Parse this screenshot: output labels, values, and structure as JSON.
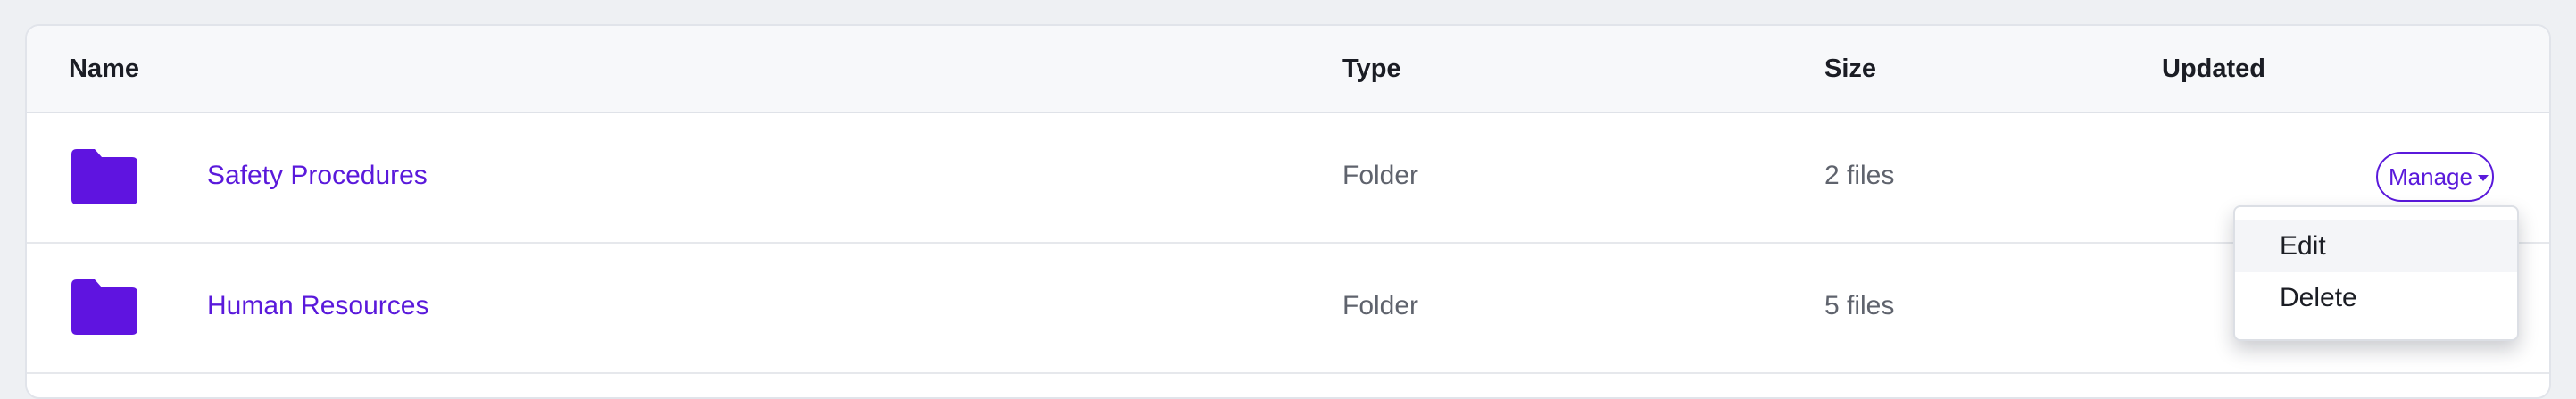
{
  "table": {
    "columns": {
      "name": "Name",
      "type": "Type",
      "size": "Size",
      "updated": "Updated"
    },
    "rows": [
      {
        "icon": "folder-icon",
        "name": "Safety Procedures",
        "type": "Folder",
        "size": "2 files",
        "updated": ""
      },
      {
        "icon": "folder-icon",
        "name": "Human Resources",
        "type": "Folder",
        "size": "5 files",
        "updated": ""
      }
    ]
  },
  "actions": {
    "manage_label": "Manage",
    "menu_items": [
      "Edit",
      "Delete"
    ]
  },
  "colors": {
    "accent": "#5a19db",
    "folder": "#5f14e0",
    "header_bg": "#f7f8fa"
  }
}
